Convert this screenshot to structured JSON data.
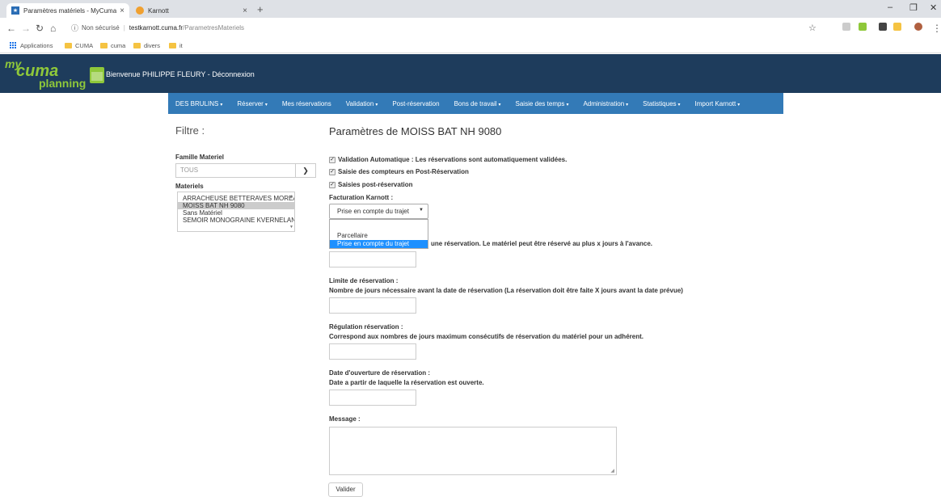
{
  "browser": {
    "tabs": [
      {
        "title": "Paramètres matériels - MyCuma"
      },
      {
        "title": "Karnott"
      }
    ],
    "url": {
      "security": "Non sécurisé",
      "host": "testkarnott.cuma.fr",
      "path": "/ParametresMateriels"
    },
    "bookmarks": [
      "Applications",
      "CUMA",
      "cuma",
      "divers",
      "it"
    ]
  },
  "header": {
    "logo_my": "my",
    "logo_cuma": "cuma",
    "logo_planning": "planning",
    "welcome": "Bienvenue PHILIPPE FLEURY - Déconnexion"
  },
  "nav": {
    "items": [
      {
        "label": "DES BRULINS",
        "caret": "▾"
      },
      {
        "label": "Réserver",
        "caret": "▾"
      },
      {
        "label": "Mes réservations",
        "caret": ""
      },
      {
        "label": "Validation",
        "caret": "▾"
      },
      {
        "label": "Post-réservation",
        "caret": ""
      },
      {
        "label": "Bons de travail",
        "caret": "▾"
      },
      {
        "label": "Saisie des temps",
        "caret": "▾"
      },
      {
        "label": "Administration",
        "caret": "▾"
      },
      {
        "label": "Statistiques",
        "caret": "▾"
      },
      {
        "label": "Import Karnott",
        "caret": "▾"
      }
    ]
  },
  "filter": {
    "title": "Filtre :",
    "famille_label": "Famille Materiel",
    "famille_value": "TOUS",
    "materiels_label": "Materiels",
    "materiels": [
      "ARRACHEUSE BETTERAVES MOREAU",
      "MOISS BAT NH 9080",
      "Sans Matériel",
      "SEMOIR MONOGRAINE KVERNELAND"
    ],
    "selected_index": 1
  },
  "form": {
    "title": "Paramètres de MOISS BAT NH 9080",
    "checkboxes": [
      {
        "label": "Validation Automatique : Les réservations sont automatiquement validées.",
        "checked": true
      },
      {
        "label": "Saisie des compteurs en Post-Réservation",
        "checked": true
      },
      {
        "label": "Saisies post-réservation",
        "checked": true
      }
    ],
    "facturation_label": "Facturation Karnott :",
    "facturation_value": "Prise en compte du trajet",
    "facturation_options": [
      "Parcellaire",
      "Prise en compte du trajet"
    ],
    "facturation_highlight": 1,
    "partial_desc": "une réservation. Le matériel peut être réservé au plus x jours à l'avance.",
    "limite_label": "Limite de réservation :",
    "limite_desc": "Nombre de jours nécessaire avant la date de réservation (La réservation doit être faite X jours avant la date prévue)",
    "regulation_label": "Régulation réservation :",
    "regulation_desc": "Correspond aux nombres de jours maximum consécutifs de réservation du matériel pour un adhérent.",
    "ouverture_label": "Date d'ouverture de réservation :",
    "ouverture_desc": "Date a partir de laquelle la réservation est ouverte.",
    "message_label": "Message :",
    "submit_label": "Valider"
  }
}
